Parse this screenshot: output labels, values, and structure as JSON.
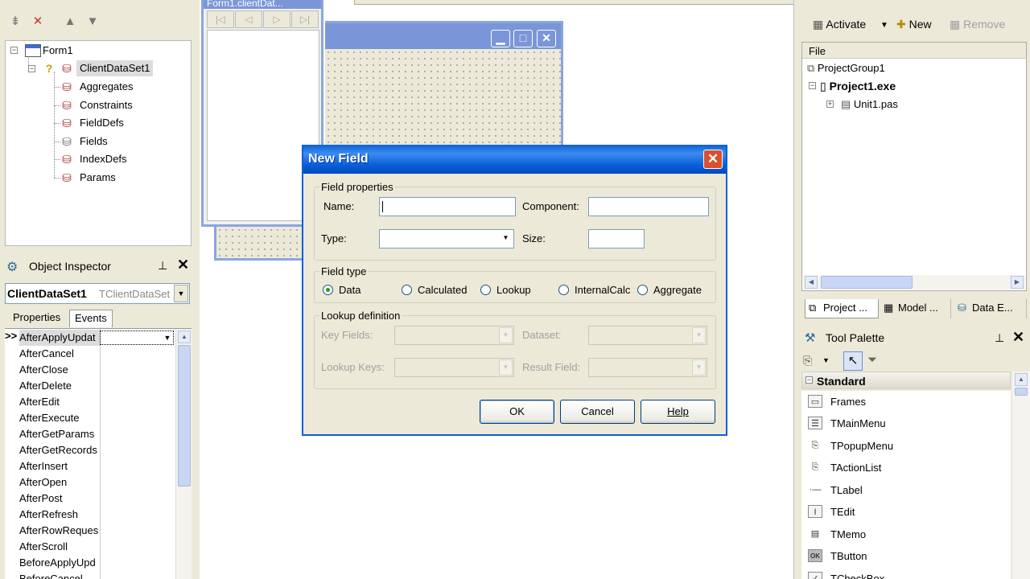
{
  "structure": {
    "tree": [
      {
        "label": "Form1"
      },
      {
        "label": "ClientDataSet1"
      },
      {
        "label": "Aggregates"
      },
      {
        "label": "Constraints"
      },
      {
        "label": "FieldDefs"
      },
      {
        "label": "Fields"
      },
      {
        "label": "IndexDefs"
      },
      {
        "label": "Params"
      }
    ]
  },
  "object_inspector": {
    "title": "Object Inspector",
    "selected_component": "ClientDataSet1",
    "selected_type": "TClientDataSet",
    "tabs": [
      "Properties",
      "Events"
    ],
    "events": [
      "AfterApplyUpdat",
      "AfterCancel",
      "AfterClose",
      "AfterDelete",
      "AfterEdit",
      "AfterExecute",
      "AfterGetParams",
      "AfterGetRecords",
      "AfterInsert",
      "AfterOpen",
      "AfterPost",
      "AfterRefresh",
      "AfterRowReques",
      "AfterScroll",
      "BeforeApplyUpd",
      "BeforeCancel"
    ],
    "active_marker": ">>"
  },
  "designer": {
    "nav_window_title": "Form1.clientDat..."
  },
  "dialog": {
    "title": "New Field",
    "field_properties": {
      "group_title": "Field properties",
      "name_label": "Name:",
      "name_value": "",
      "component_label": "Component:",
      "component_value": "",
      "type_label": "Type:",
      "type_value": "",
      "size_label": "Size:",
      "size_value": ""
    },
    "field_type": {
      "group_title": "Field type",
      "options": [
        "Data",
        "Calculated",
        "Lookup",
        "InternalCalc",
        "Aggregate"
      ],
      "selected": "Data"
    },
    "lookup_definition": {
      "group_title": "Lookup definition",
      "key_fields_label": "Key Fields:",
      "dataset_label": "Dataset:",
      "lookup_keys_label": "Lookup Keys:",
      "result_field_label": "Result Field:"
    },
    "buttons": {
      "ok": "OK",
      "cancel": "Cancel",
      "help": "Help"
    }
  },
  "project_manager": {
    "activate_label": "Activate",
    "new_label": "New",
    "remove_label": "Remove",
    "column_header": "File",
    "tree": [
      {
        "label": "ProjectGroup1"
      },
      {
        "label": "Project1.exe"
      },
      {
        "label": "Unit1.pas"
      }
    ],
    "tabs": [
      "Project ...",
      "Model ...",
      "Data E..."
    ]
  },
  "tool_palette": {
    "title": "Tool Palette",
    "category": "Standard",
    "items": [
      "Frames",
      "TMainMenu",
      "TPopupMenu",
      "TActionList",
      "TLabel",
      "TEdit",
      "TMemo",
      "TButton",
      "TCheckBox"
    ]
  },
  "colors": {
    "xp_title_blue": "#0a5fd8",
    "xp_close_red": "#d9502c",
    "face": "#ece9d8"
  }
}
